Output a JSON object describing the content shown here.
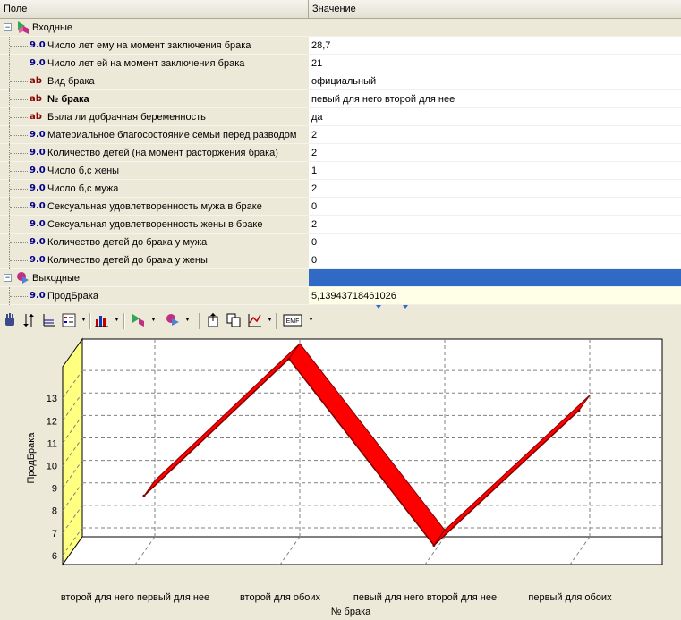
{
  "grid": {
    "col_field": "Поле",
    "col_value": "Значение",
    "inputs_group": "Входные",
    "outputs_group": "Выходные",
    "inputs": [
      {
        "type": "9.0",
        "label": "Число лет ему на момент заключения брака",
        "value": "28,7"
      },
      {
        "type": "9.0",
        "label": "Число лет ей на момент заключения брака",
        "value": "21"
      },
      {
        "type": "ab",
        "label": "Вид брака",
        "value": "официальный"
      },
      {
        "type": "ab",
        "label": "№ брака",
        "value": "певый для него второй для нее",
        "bold": true
      },
      {
        "type": "ab",
        "label": "Была ли добрачная беременность",
        "value": "да"
      },
      {
        "type": "9.0",
        "label": "Материальное благосостояние семьи перед разводом",
        "value": "2"
      },
      {
        "type": "9.0",
        "label": "Количество детей (на момент расторжения брака)",
        "value": "2"
      },
      {
        "type": "9.0",
        "label": "Число б,с жены",
        "value": "1"
      },
      {
        "type": "9.0",
        "label": "Число б,с мужа",
        "value": "2"
      },
      {
        "type": "9.0",
        "label": "Сексуальная удовлетворенность мужа в браке",
        "value": "0"
      },
      {
        "type": "9.0",
        "label": "Сексуальная удовлетворенность жены в браке",
        "value": "2"
      },
      {
        "type": "9.0",
        "label": "Количество детей до брака у мужа",
        "value": "0"
      },
      {
        "type": "9.0",
        "label": "Количество детей до брака у жены",
        "value": "0"
      }
    ],
    "outputs": [
      {
        "type": "9.0",
        "label": "ПродБрака",
        "value": "5,13943718461026"
      }
    ]
  },
  "toolbar": {
    "emf_label": "EMF",
    "icons": [
      "hand-icon",
      "sort-icon",
      "axes-icon",
      "legend-icon",
      "bar-chart-icon",
      "input-fields-icon",
      "output-fields-icon",
      "export-icon",
      "copy-icon",
      "line-chart-icon",
      "emf-icon"
    ]
  },
  "colors": {
    "line": "#800000",
    "band": "#ff0000",
    "wall": "#ffff80",
    "selection": "#316ac5"
  },
  "chart_data": {
    "type": "line",
    "ylabel": "ПродБрака",
    "xlabel": "№ брака",
    "categories": [
      "второй для него первый для нее",
      "второй для обоих",
      "певый для него второй для нее",
      "первый для обоих"
    ],
    "series": [
      {
        "values": [
          8.1,
          14.2,
          5.9,
          11.9
        ]
      }
    ],
    "yticks": [
      6,
      7,
      8,
      9,
      10,
      11,
      12,
      13
    ],
    "ylim": [
      5.6,
      14.4
    ],
    "grid": true,
    "style": "3d"
  }
}
